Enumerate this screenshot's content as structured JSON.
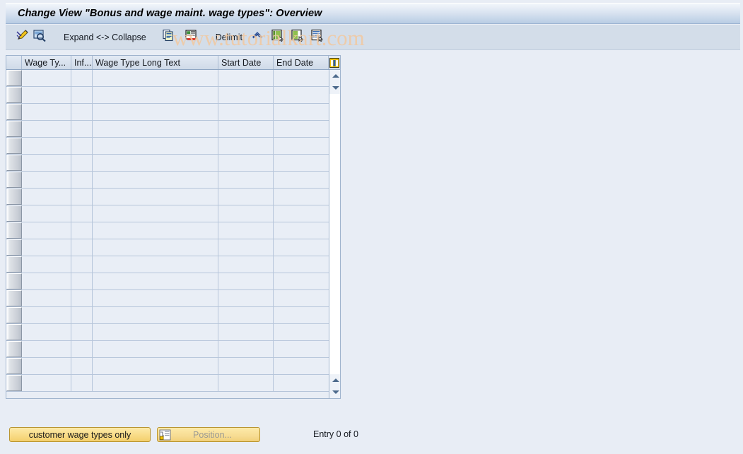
{
  "window": {
    "title": "Change View \"Bonus and wage maint. wage types\": Overview"
  },
  "watermark": {
    "text": "www.tutorialkart.com",
    "color": "#f2c9a0"
  },
  "toolbar": {
    "items": [
      {
        "name": "edit-pencil-icon",
        "type": "icon",
        "label": ""
      },
      {
        "name": "display-magnifier-icon",
        "type": "icon",
        "label": ""
      },
      {
        "name": "expand-collapse-button",
        "type": "label",
        "label": "Expand <-> Collapse"
      },
      {
        "name": "copy-icon",
        "type": "icon",
        "label": ""
      },
      {
        "name": "delete-row-icon",
        "type": "icon",
        "label": ""
      },
      {
        "name": "delimit-button",
        "type": "label",
        "label": "Delimit"
      },
      {
        "name": "undo-icon",
        "type": "icon",
        "label": ""
      },
      {
        "name": "select-all-icon",
        "type": "icon",
        "label": ""
      },
      {
        "name": "deselect-all-icon",
        "type": "icon",
        "label": ""
      },
      {
        "name": "variant-icon",
        "type": "icon",
        "label": ""
      }
    ],
    "expand_collapse_label": "Expand <-> Collapse",
    "delimit_label": "Delimit"
  },
  "table": {
    "columns": [
      {
        "key": "selector",
        "label": ""
      },
      {
        "key": "wage_type",
        "label": "Wage Ty..."
      },
      {
        "key": "infotype",
        "label": "Inf..."
      },
      {
        "key": "long_text",
        "label": "Wage Type Long Text"
      },
      {
        "key": "start_date",
        "label": "Start Date"
      },
      {
        "key": "end_date",
        "label": "End Date"
      }
    ],
    "config_icon": "table-settings-icon",
    "rows": [],
    "empty_row_count": 19,
    "scrollbar": {
      "up_icon": "scroll-up-arrow-icon",
      "down_icon": "scroll-down-arrow-icon"
    }
  },
  "footer": {
    "customer_wage_types_button": "customer wage types only",
    "position_button": "Position...",
    "position_icon": "position-goto-icon",
    "entry_status": "Entry 0 of 0"
  }
}
